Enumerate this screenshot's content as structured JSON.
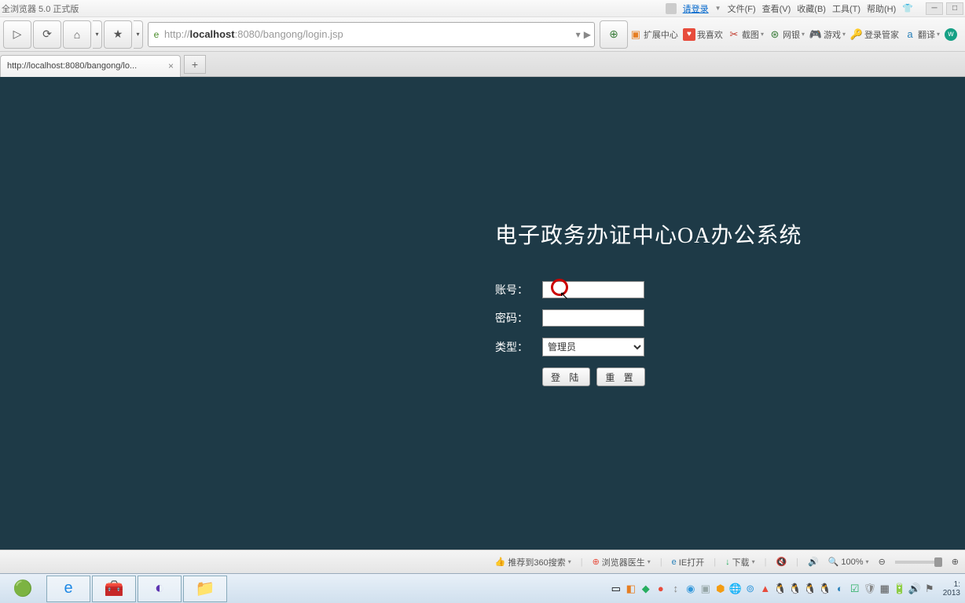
{
  "browser": {
    "title": "全浏览器 5.0 正式版",
    "login_prompt": "请登录",
    "menus": {
      "file": "文件(F)",
      "view": "查看(V)",
      "favorites": "收藏(B)",
      "tools": "工具(T)",
      "help": "帮助(H)"
    }
  },
  "address": {
    "protocol": "http://",
    "host": "localhost",
    "port_path": ":8080/bangong/login.jsp"
  },
  "toolbar": {
    "extensions": "扩展中心",
    "like": "我喜欢",
    "screenshot": "截图",
    "netbank": "网银",
    "games": "游戏",
    "login_manager": "登录管家",
    "translate": "翻译"
  },
  "tab": {
    "title": "http://localhost:8080/bangong/lo..."
  },
  "page": {
    "title": "电子政务办证中心OA办公系统",
    "labels": {
      "account": "账号：",
      "password": "密码：",
      "type": "类型："
    },
    "type_selected": "管理员",
    "buttons": {
      "login": "登 陆",
      "reset": "重 置"
    }
  },
  "status": {
    "recommend": "推荐到360搜索",
    "doctor": "浏览器医生",
    "ie_open": "IE打开",
    "download": "下载",
    "zoom": "100%"
  },
  "clock": {
    "time": "1:",
    "date": "2013"
  }
}
